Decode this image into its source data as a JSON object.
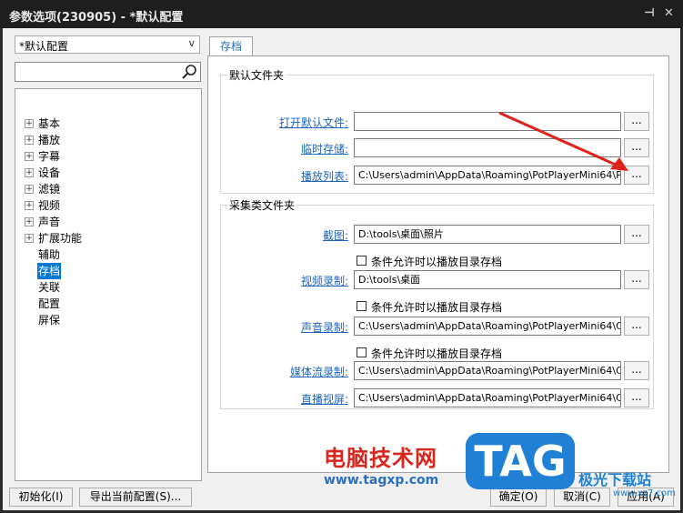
{
  "window": {
    "title": "参数选项(230905) - *默认配置",
    "pin_glyph": "⊣",
    "close_glyph": "✕"
  },
  "profile_combo": {
    "value": "*默认配置",
    "arrow": "v"
  },
  "search": {
    "placeholder": ""
  },
  "tree": {
    "items": [
      {
        "label": "基本",
        "expander": "+"
      },
      {
        "label": "播放",
        "expander": "+"
      },
      {
        "label": "字幕",
        "expander": "+"
      },
      {
        "label": "设备",
        "expander": "+"
      },
      {
        "label": "滤镜",
        "expander": "+"
      },
      {
        "label": "视频",
        "expander": "+"
      },
      {
        "label": "声音",
        "expander": "+"
      },
      {
        "label": "扩展功能",
        "expander": "+"
      },
      {
        "label": "辅助",
        "expander": ""
      },
      {
        "label": "存档",
        "expander": "",
        "selected": true
      },
      {
        "label": "关联",
        "expander": ""
      },
      {
        "label": "配置",
        "expander": ""
      },
      {
        "label": "屏保",
        "expander": ""
      }
    ]
  },
  "tab": {
    "label": "存档"
  },
  "default_folders": {
    "title": "默认文件夹",
    "rows": [
      {
        "label": "打开默认文件:",
        "value": ""
      },
      {
        "label": "临时存储:",
        "value": ""
      },
      {
        "label": "播放列表:",
        "value": "C:\\Users\\admin\\AppData\\Roaming\\PotPlayerMini64\\P"
      }
    ]
  },
  "capture_folders": {
    "title": "采集类文件夹",
    "rows": [
      {
        "label": "截图:",
        "value": "D:\\tools\\桌面\\照片",
        "checkbox": "条件允许时以播放目录存档"
      },
      {
        "label": "视频录制:",
        "value": "D:\\tools\\桌面",
        "checkbox": "条件允许时以播放目录存档"
      },
      {
        "label": "声音录制:",
        "value": "C:\\Users\\admin\\AppData\\Roaming\\PotPlayerMini64\\C",
        "checkbox": "条件允许时以播放目录存档"
      },
      {
        "label": "媒体流录制:",
        "value": "C:\\Users\\admin\\AppData\\Roaming\\PotPlayerMini64\\C"
      },
      {
        "label": "直播视屏:",
        "value": "C:\\Users\\admin\\AppData\\Roaming\\PotPlayerMini64\\C"
      }
    ]
  },
  "browse_label": "...",
  "footer": {
    "init_button": "初始化(I)",
    "export_button": "导出当前配置(S)...",
    "ok_button": "确定(O)",
    "cancel_button": "取消(C)",
    "apply_button": "应用(A)"
  },
  "watermark": {
    "brand_cn": "电脑技术网",
    "brand_url": "www.tagxp.com",
    "tag_logo": "TAG",
    "site_cn": "极光下载站",
    "site_url": "www.xz7.com"
  },
  "colors": {
    "accent": "#0078d7",
    "link": "#2065b8",
    "arrow": "#e0221a"
  }
}
